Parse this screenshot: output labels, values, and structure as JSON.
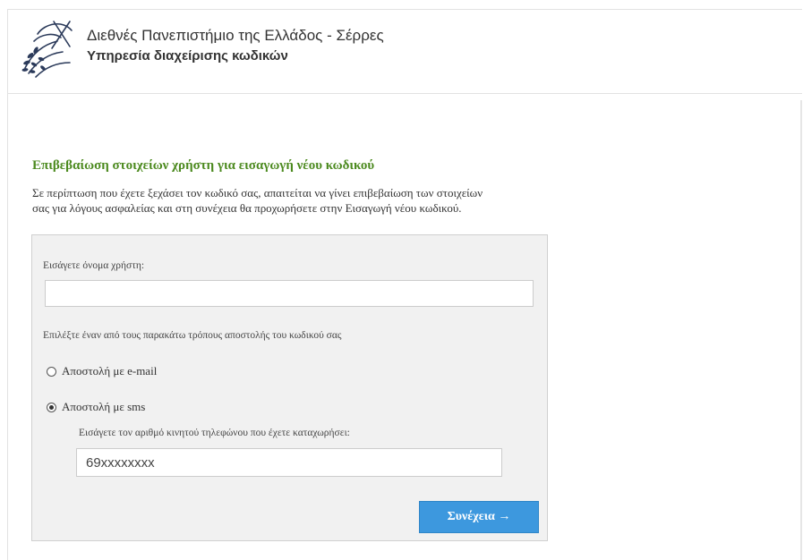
{
  "header": {
    "university": "Διεθνές Πανεπιστήμιο της Ελλάδος - Σέρρες",
    "service": "Υπηρεσία διαχείρισης κωδικών"
  },
  "main": {
    "title": "Επιβεβαίωση στοιχείων χρήστη για εισαγωγή νέου κωδικού",
    "intro_line1": "Σε περίπτωση που έχετε ξεχάσει τον κωδικό σας, απαιτείται να γίνει επιβεβαίωση των στοιχείων",
    "intro_line2": "σας για λόγους ασφαλείας και στη συνέχεια θα προχωρήσετε στην Εισαγωγή νέου κωδικού."
  },
  "form": {
    "username_label": "Εισάγετε όνομα χρήστη:",
    "username_value": "",
    "method_label": "Επιλέξτε έναν από τους παρακάτω τρόπους αποστολής του κωδικού σας",
    "option_email": "Αποστολή με e-mail",
    "option_sms": "Αποστολή με sms",
    "selected_option": "sms",
    "phone_label": "Εισάγετε τον αριθμό κινητού τηλεφώνου που έχετε καταχωρήσει:",
    "phone_value": "69xxxxxxxx",
    "submit_label": "Συνέχεια →"
  },
  "colors": {
    "title_green": "#4c8a1f",
    "button_blue": "#3d98de"
  },
  "icons": {
    "logo": "olive-branch-globe-logo"
  }
}
